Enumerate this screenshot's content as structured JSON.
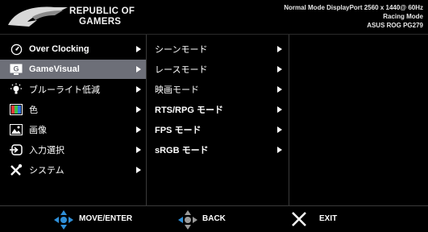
{
  "header": {
    "brand_line1": "REPUBLIC OF",
    "brand_line2": "GAMERS",
    "status_line1": "Normal Mode DisplayPort 2560 x 1440@ 60Hz",
    "status_line2": "Racing Mode",
    "status_line3": "ASUS ROG PG279"
  },
  "main_menu": [
    {
      "label": "Over Clocking",
      "icon": "gauge-icon"
    },
    {
      "label": "GameVisual",
      "icon": "gamevisual-icon",
      "active": true
    },
    {
      "label": "ブルーライト低減",
      "icon": "bulb-icon"
    },
    {
      "label": "色",
      "icon": "color-icon"
    },
    {
      "label": "画像",
      "icon": "image-icon"
    },
    {
      "label": "入力選択",
      "icon": "input-icon"
    },
    {
      "label": "システム",
      "icon": "tools-icon"
    }
  ],
  "sub_menu": [
    {
      "label": "シーンモード"
    },
    {
      "label": "レースモード"
    },
    {
      "label": "映画モード"
    },
    {
      "label": "RTS/RPG モード"
    },
    {
      "label": "FPS モード"
    },
    {
      "label": "sRGB モード"
    }
  ],
  "footer": {
    "move_label": "MOVE/ENTER",
    "back_label": "BACK",
    "exit_label": "EXIT"
  },
  "colors": {
    "active_bg": "#6d6f78",
    "joystick_blue": "#2f8fd8"
  }
}
